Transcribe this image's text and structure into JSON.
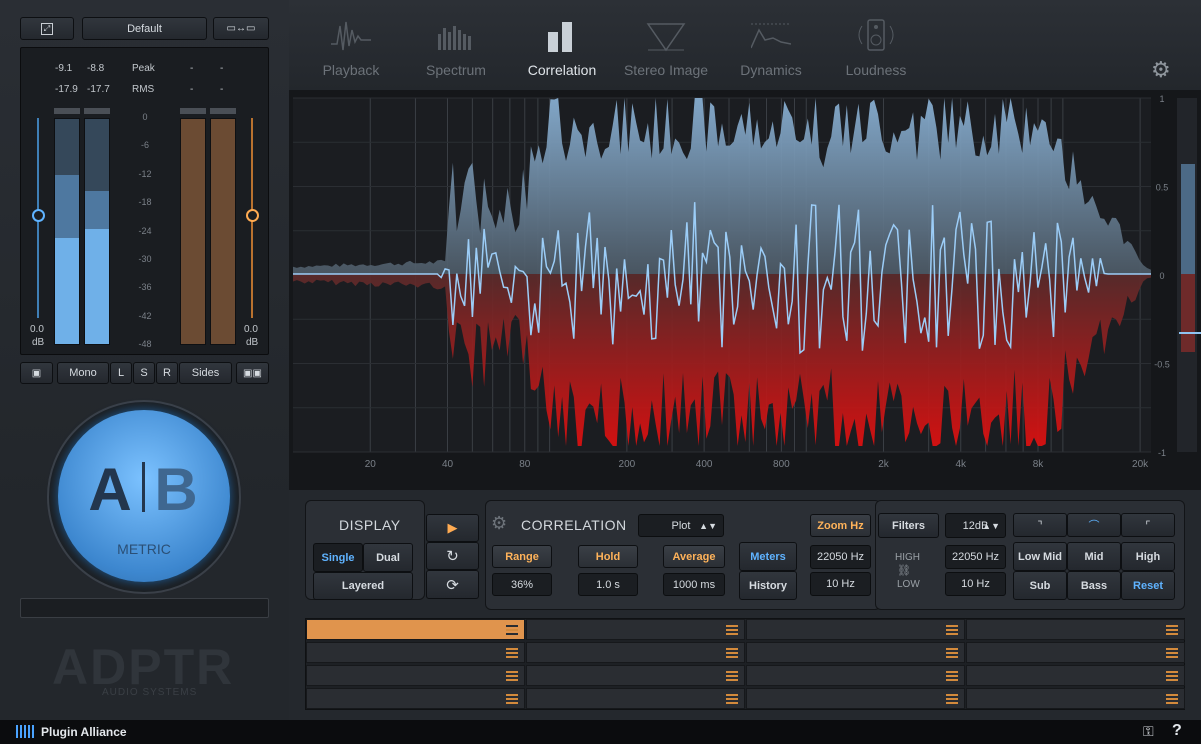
{
  "top": {
    "preset": "Default",
    "expand_icon": "expand-icon",
    "ab_compare_icon": "ab-compare-icon"
  },
  "meter": {
    "peak_l": "-9.1",
    "peak_r": "-8.8",
    "peak_label": "Peak",
    "peak_ref_l": "-",
    "peak_ref_r": "-",
    "rms_l": "-17.9",
    "rms_r": "-17.7",
    "rms_label": "RMS",
    "rms_ref_l": "-",
    "rms_ref_r": "-",
    "scale": [
      "0",
      "-6",
      "-12",
      "-18",
      "-24",
      "-30",
      "-36",
      "-42",
      "-48"
    ],
    "gain_l": "0.0",
    "gain_l_unit": "dB",
    "gain_r": "0.0",
    "gain_r_unit": "dB",
    "level_l_rms": 0.47,
    "level_l_peak": 0.75,
    "level_r_rms": 0.51,
    "level_r_peak": 0.68
  },
  "monitor": {
    "mono": "Mono",
    "l": "L",
    "s": "S",
    "r": "R",
    "sides": "Sides"
  },
  "ab": {
    "a": "A",
    "b": "B",
    "mode": "METRIC"
  },
  "brand": {
    "logo": "ADPTR",
    "sub": "AUDIO SYSTEMS",
    "footer": "Plugin Alliance"
  },
  "tabs": [
    {
      "label": "Playback",
      "icon": "playback-icon"
    },
    {
      "label": "Spectrum",
      "icon": "spectrum-icon"
    },
    {
      "label": "Correlation",
      "icon": "correlation-icon"
    },
    {
      "label": "Stereo Image",
      "icon": "stereo-image-icon"
    },
    {
      "label": "Dynamics",
      "icon": "dynamics-icon"
    },
    {
      "label": "Loudness",
      "icon": "loudness-icon"
    }
  ],
  "active_tab": "Correlation",
  "plot": {
    "x_ticks": [
      "20",
      "40",
      "80",
      "200",
      "400",
      "800",
      "2k",
      "4k",
      "8k",
      "20k"
    ],
    "y_ticks": [
      "1",
      "0.5",
      "0",
      "-0.5",
      "-1"
    ]
  },
  "display": {
    "title": "DISPLAY",
    "single": "Single",
    "dual": "Dual",
    "layered": "Layered"
  },
  "correlation": {
    "title": "CORRELATION",
    "mode": "Plot",
    "range_label": "Range",
    "range_value": "36%",
    "hold_label": "Hold",
    "hold_value": "1.0 s",
    "average_label": "Average",
    "average_value": "1000 ms",
    "meters": "Meters",
    "history": "History"
  },
  "filters": {
    "zoom": "Zoom Hz",
    "filters": "Filters",
    "slope": "12dB",
    "high_freq_l": "22050 Hz",
    "low_freq_l": "10 Hz",
    "high_label": "HIGH",
    "low_label": "LOW",
    "high_freq_r": "22050 Hz",
    "low_freq_r": "10 Hz",
    "bands": [
      "Low Mid",
      "Mid",
      "High",
      "Sub",
      "Bass",
      "Reset"
    ]
  },
  "colors": {
    "accent": "#5fb3ff",
    "orange": "#ffab52",
    "red": "#d01010",
    "blue_fill": "#7fa6c8"
  }
}
